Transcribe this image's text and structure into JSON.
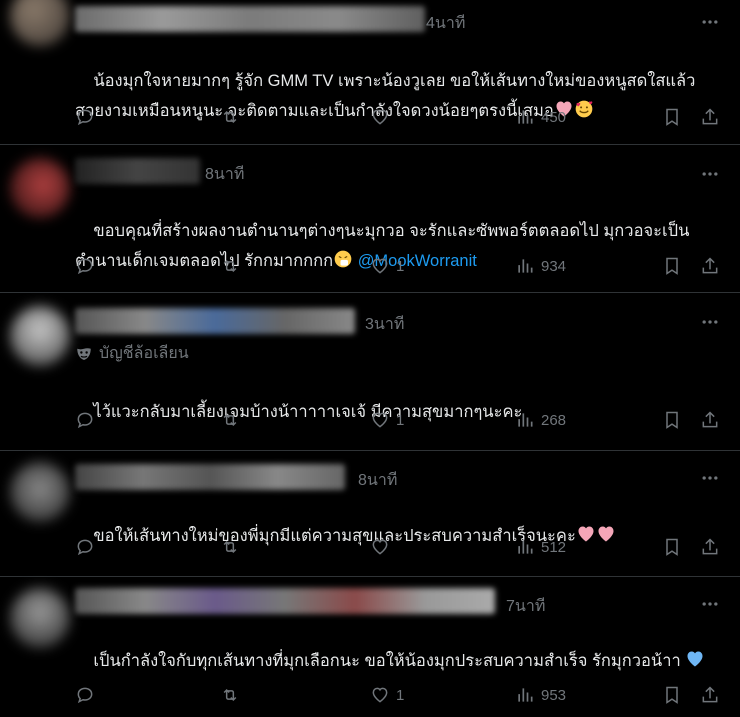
{
  "tweets": [
    {
      "time": "4นาที",
      "text": "น้องมุกใจหายมากๆ รู้จัก GMM TV เพราะน้องวูเลย ขอให้เส้นทางใหม่ของหนูสดใสแล้วสวยงามเหมือนหนูนะ จะติดตามและเป็นกำลังใจดวงน้อยๆตรงนี้เสมอ",
      "likes": "",
      "views": "450"
    },
    {
      "time": "8นาที",
      "text": "ขอบคุณที่สร้างผลงานตำนานๆต่างๆนะมุกวอ จะรักและซัพพอร์ตตลอดไป มุกวอจะเป็นตำนานเด็กเจมตลอดไป รักกมากกกก",
      "mention": "@MookWorranit",
      "likes": "1",
      "views": "934"
    },
    {
      "time": "3นาที",
      "anon_label": "บัญชีล้อเลียน",
      "text": "ไว้แวะกลับมาเลี้ยงเจมบ้างน้าาาาาเจเจ้ มีความสุขมากๆนะคะ",
      "likes": "1",
      "views": "268"
    },
    {
      "time": "8นาที",
      "text": "ขอให้เส้นทางใหม่ของพี่มุกมีแต่ความสุขและประสบความสำเร็จนะคะ",
      "likes": "",
      "views": "512"
    },
    {
      "time": "7นาที",
      "text": "เป็นกำลังใจกับทุกเส้นทางที่มุกเลือกนะ ขอให้น้องมุกประสบความสำเร็จ รักมุกวอน้าา",
      "likes": "1",
      "views": "953"
    }
  ],
  "colors": {
    "background": "#000000",
    "text": "#e7e9ea",
    "muted": "#71767b",
    "mention": "#1d9bf0",
    "divider": "#2f3336",
    "heart_pink": "#f4a6b8",
    "heart_blue": "#6fb7f5"
  },
  "icons": [
    "reply-icon",
    "retweet-icon",
    "like-icon",
    "views-icon",
    "bookmark-icon",
    "share-icon",
    "more-icon",
    "mask-icon"
  ]
}
